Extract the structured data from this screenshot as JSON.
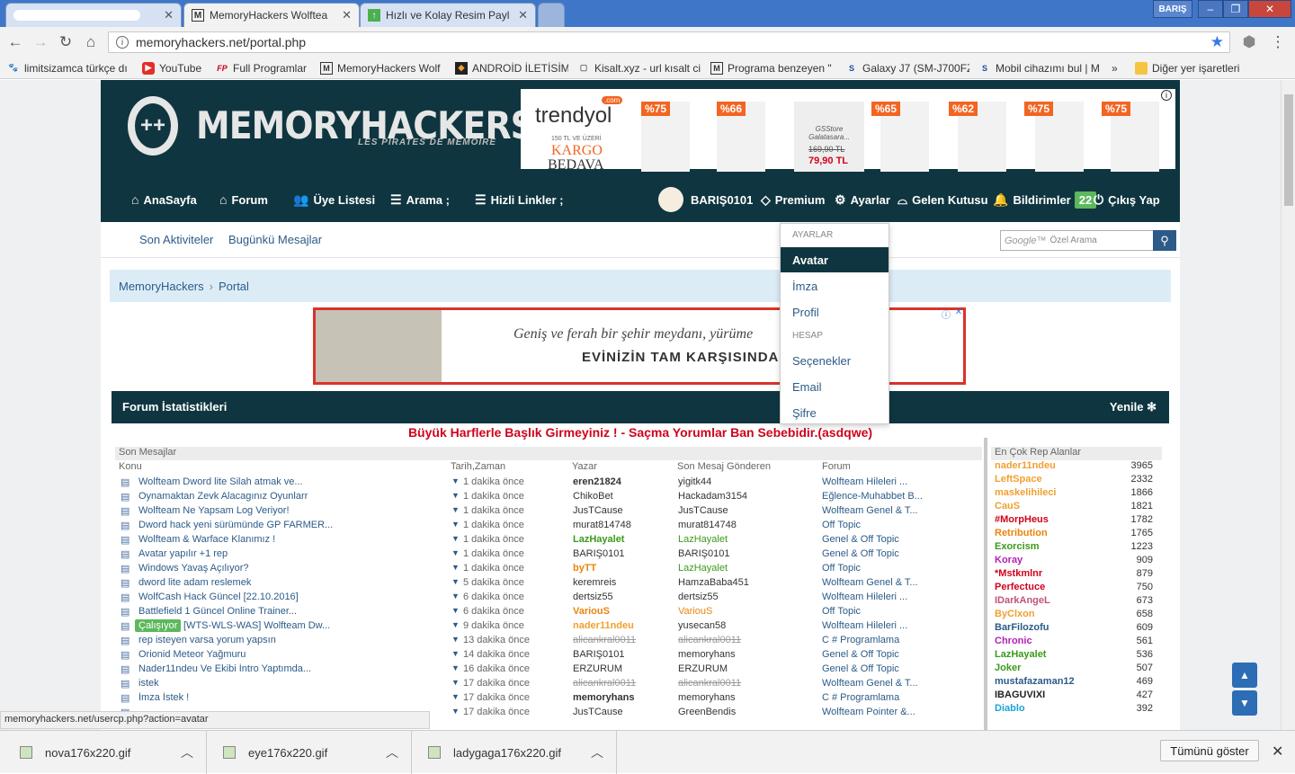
{
  "browser": {
    "tabs": [
      {
        "title": "",
        "icon": ""
      },
      {
        "title": "MemoryHackers Wolftea",
        "icon": "M"
      },
      {
        "title": "Hızlı ve Kolay Resim Payl",
        "icon": "↑"
      }
    ],
    "user_badge": "BARIŞ",
    "url": "memoryhackers.net/portal.php",
    "bookmarks": [
      {
        "label": "limitsizamca türkçe dı",
        "icon": "🐾"
      },
      {
        "label": "YouTube",
        "icon": "▶"
      },
      {
        "label": "Full Programlar",
        "icon": "FP"
      },
      {
        "label": "MemoryHackers Wolf",
        "icon": "M"
      },
      {
        "label": "ANDROİD İLETİSİM",
        "icon": "◆"
      },
      {
        "label": "Kisalt.xyz - url kısalt ci",
        "icon": "▢"
      },
      {
        "label": "Programa benzeyen \"",
        "icon": "M"
      },
      {
        "label": "Galaxy J7 (SM-J700FZ",
        "icon": "S"
      },
      {
        "label": "Mobil cihazımı bul | M",
        "icon": "S"
      }
    ],
    "bookmarks_more": "»",
    "other_bookmarks": "Diğer yer işaretleri",
    "status_url": "memoryhackers.net/usercp.php?action=avatar"
  },
  "header": {
    "logo": "MEMORYHACKERS",
    "logo_sub": "LES PIRATES DE MEMOIRE",
    "logo_glyph": "++",
    "ad": {
      "brand": "trendyol",
      "brand_tag": ".com",
      "promo_line": "150 TL VE ÜZERİ",
      "promo_a": "KARGO",
      "promo_b": "BEDAVA",
      "badges": [
        "%75",
        "%66",
        "%65",
        "%62",
        "%75",
        "%75"
      ],
      "store": "GSStore Galatasara...",
      "old_price": "169,90 TL",
      "new_price": "79,90 TL",
      "info_icon": "i"
    }
  },
  "nav": {
    "home": "AnaSayfa",
    "forum": "Forum",
    "members": "Üye Listesi",
    "search": "Arama ;",
    "quicklinks": "Hizli Linkler ;",
    "username": "BARIŞ0101",
    "premium": "Premium",
    "settings": "Ayarlar",
    "inbox": "Gelen Kutusu",
    "notifications": "Bildirimler",
    "notif_count": "22",
    "logout": "Çıkış Yap"
  },
  "subnav": {
    "recent": "Son Aktiviteler",
    "today": "Bugünkü Mesajlar",
    "search_placeholder": "Özel Arama",
    "search_brand": "Google™"
  },
  "breadcrumb": {
    "root": "MemoryHackers",
    "sep": "›",
    "current": "Portal"
  },
  "ad2": {
    "line1": "Geniş ve ferah bir şehir meydanı, yürüme",
    "line2": "EVİNİZİN TAM KARŞISINDA"
  },
  "dropdown": {
    "section1": "AYARLAR",
    "items1": [
      "Avatar",
      "İmza",
      "Profil"
    ],
    "section2": "HESAP",
    "items2": [
      "Seçenekler",
      "Email",
      "Şifre"
    ]
  },
  "stats": {
    "title": "Forum İstatistikleri",
    "refresh": "Yenile",
    "warning": "Büyük Harflerle Başlık Girmeyiniz ! - Saçma Yorumlar Ban Sebebidir.(asdqwe)",
    "section_label": "Son Mesajlar",
    "columns": [
      "Konu",
      "Tarih,Zaman",
      "Yazar",
      "Son Mesaj Gönderen",
      "Forum"
    ],
    "rows": [
      {
        "topic": "Wolfteam Dword lite Silah atmak ve...",
        "time": "1 dakika önce",
        "author": "eren21824",
        "author_color": "#333",
        "author_bold": true,
        "last": "yigitk44",
        "last_color": "#333",
        "forum": "Wolfteam Hileleri ...",
        "badge": ""
      },
      {
        "topic": "Oynamaktan Zevk Alacagınız Oyunlarr",
        "time": "1 dakika önce",
        "author": "ChikoBet",
        "author_color": "#333",
        "author_bold": false,
        "last": "Hackadam3154",
        "last_color": "#333",
        "forum": "Eğlence-Muhabbet B...",
        "badge": ""
      },
      {
        "topic": "Wolfteam Ne Yapsam Log Veriyor!",
        "time": "1 dakika önce",
        "author": "JusTCause",
        "author_color": "#333",
        "author_bold": false,
        "last": "JusTCause",
        "last_color": "#333",
        "forum": "Wolfteam Genel & T...",
        "badge": ""
      },
      {
        "topic": "Dword hack yeni sürümünde GP FARMER...",
        "time": "1 dakika önce",
        "author": "murat814748",
        "author_color": "#333",
        "author_bold": false,
        "last": "murat814748",
        "last_color": "#333",
        "forum": "Off Topic",
        "badge": ""
      },
      {
        "topic": "Wolfteam & Warface Klanımız !",
        "time": "1 dakika önce",
        "author": "LazHayalet",
        "author_color": "#3a9a1a",
        "author_bold": true,
        "last": "LazHayalet",
        "last_color": "#3a9a1a",
        "forum": "Genel & Off Topic",
        "badge": ""
      },
      {
        "topic": "Avatar yapılır +1 rep",
        "time": "1 dakika önce",
        "author": "BARIŞ0101",
        "author_color": "#333",
        "author_bold": false,
        "last": "BARIŞ0101",
        "last_color": "#333",
        "forum": "Genel & Off Topic",
        "badge": ""
      },
      {
        "topic": "Windows Yavaş Açılıyor?",
        "time": "1 dakika önce",
        "author": "byTT",
        "author_color": "#e8850c",
        "author_bold": true,
        "last": "LazHayalet",
        "last_color": "#3a9a1a",
        "forum": "Off Topic",
        "badge": ""
      },
      {
        "topic": "dword lite adam reslemek",
        "time": "5 dakika önce",
        "author": "keremreis",
        "author_color": "#333",
        "author_bold": false,
        "last": "HamzaBaba451",
        "last_color": "#333",
        "forum": "Wolfteam Genel & T...",
        "badge": ""
      },
      {
        "topic": "WolfCash Hack Güncel [22.10.2016]",
        "time": "6 dakika önce",
        "author": "dertsiz55",
        "author_color": "#333",
        "author_bold": false,
        "last": "dertsiz55",
        "last_color": "#333",
        "forum": "Wolfteam Hileleri ...",
        "badge": ""
      },
      {
        "topic": "Battlefield 1 Güncel Online Trainer...",
        "time": "6 dakika önce",
        "author": "VariouS",
        "author_color": "#e8850c",
        "author_bold": true,
        "last": "VariouS",
        "last_color": "#e8850c",
        "forum": "Off Topic",
        "badge": ""
      },
      {
        "topic": "[WTS-WLS-WAS] Wolfteam Dw...",
        "time": "9 dakika önce",
        "author": "nader11ndeu",
        "author_color": "#f0a030",
        "author_bold": true,
        "last": "yusecan58",
        "last_color": "#333",
        "forum": "Wolfteam Hileleri ...",
        "badge": "Çalışıyor"
      },
      {
        "topic": "rep isteyen varsa yorum yapsın",
        "time": "13 dakika önce",
        "author": "alicankral0011",
        "author_color": "#999",
        "author_bold": false,
        "last": "alicankral0011",
        "last_color": "#999",
        "forum": "C # Programlama",
        "badge": ""
      },
      {
        "topic": "Orionid Meteor Yağmuru",
        "time": "14 dakika önce",
        "author": "BARIŞ0101",
        "author_color": "#333",
        "author_bold": false,
        "last": "memoryhans",
        "last_color": "#333",
        "forum": "Genel & Off Topic",
        "badge": ""
      },
      {
        "topic": "Nader11ndeu Ve Ekibi İntro Yaptımda...",
        "time": "16 dakika önce",
        "author": "ERZURUM",
        "author_color": "#333",
        "author_bold": false,
        "last": "ERZURUM",
        "last_color": "#333",
        "forum": "Genel & Off Topic",
        "badge": ""
      },
      {
        "topic": "istek",
        "time": "17 dakika önce",
        "author": "alicankral0011",
        "author_color": "#999",
        "author_bold": false,
        "last": "alicankral0011",
        "last_color": "#999",
        "forum": "Wolfteam Genel & T...",
        "badge": ""
      },
      {
        "topic": "İmza İstek !",
        "time": "17 dakika önce",
        "author": "memoryhans",
        "author_color": "#333",
        "author_bold": true,
        "last": "memoryhans",
        "last_color": "#333",
        "forum": "C # Programlama",
        "badge": ""
      },
      {
        "topic": "",
        "time": "17 dakika önce",
        "author": "JusTCause",
        "author_color": "#333",
        "author_bold": false,
        "last": "GreenBendis",
        "last_color": "#333",
        "forum": "Wolfteam Pointer &...",
        "badge": ""
      }
    ],
    "rep_title": "En Çok Rep Alanlar",
    "rep": [
      {
        "name": "nader11ndeu",
        "value": "3965",
        "color": "#f0a030"
      },
      {
        "name": "LeftSpace",
        "value": "2332",
        "color": "#f0a030"
      },
      {
        "name": "maskelihileci",
        "value": "1866",
        "color": "#f0a030"
      },
      {
        "name": "CauS",
        "value": "1821",
        "color": "#f0a030"
      },
      {
        "name": "#MorpHeus",
        "value": "1782",
        "color": "#d0021b"
      },
      {
        "name": "Retribution",
        "value": "1765",
        "color": "#e8850c"
      },
      {
        "name": "Exorcism",
        "value": "1223",
        "color": "#3a9a1a"
      },
      {
        "name": "Koray",
        "value": "909",
        "color": "#b41fb4"
      },
      {
        "name": "*Mstkmlnr",
        "value": "879",
        "color": "#d0021b"
      },
      {
        "name": "Perfectuce",
        "value": "750",
        "color": "#d0021b"
      },
      {
        "name": "IDarkAngeL",
        "value": "673",
        "color": "#c0547c"
      },
      {
        "name": "ByClxon",
        "value": "658",
        "color": "#f0a030"
      },
      {
        "name": "BarFilozofu",
        "value": "609",
        "color": "#2c5b88"
      },
      {
        "name": "Chronic",
        "value": "561",
        "color": "#b41fb4"
      },
      {
        "name": "LazHayalet",
        "value": "536",
        "color": "#3a9a1a"
      },
      {
        "name": "Joker",
        "value": "507",
        "color": "#3a9a1a"
      },
      {
        "name": "mustafazaman12",
        "value": "469",
        "color": "#2c5b88"
      },
      {
        "name": "IBAGUVIXI",
        "value": "427",
        "color": "#222"
      },
      {
        "name": "Diablo",
        "value": "392",
        "color": "#1aa3d9"
      }
    ]
  },
  "downloads": {
    "files": [
      "nova176x220.gif",
      "eye176x220.gif",
      "ladygaga176x220.gif"
    ],
    "show_all": "Tümünü göster"
  }
}
